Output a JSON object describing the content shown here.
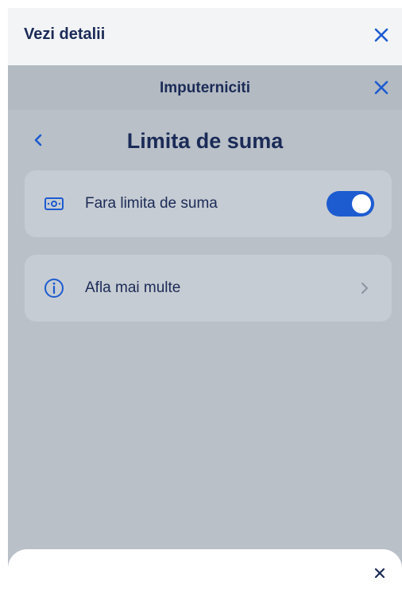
{
  "outer_sheet": {
    "title": "Vezi detalii",
    "close_icon": "close-icon"
  },
  "inner_modal": {
    "title": "Imputerniciti",
    "close_icon": "close-icon"
  },
  "page": {
    "back_icon": "chevron-left-icon",
    "title": "Limita de suma"
  },
  "options": [
    {
      "icon": "banknote-icon",
      "label": "Fara limita de suma",
      "control": "toggle",
      "toggle_on": true
    },
    {
      "icon": "info-icon",
      "label": "Afla mai multe",
      "control": "chevron-right-icon"
    }
  ],
  "bottom_sheet": {
    "close_icon": "close-icon"
  },
  "colors": {
    "primary_text": "#1b2b57",
    "accent_blue": "#1d5bd0",
    "overlay_bg": "#b9c0c8",
    "card_bg": "#c6ccd3"
  }
}
